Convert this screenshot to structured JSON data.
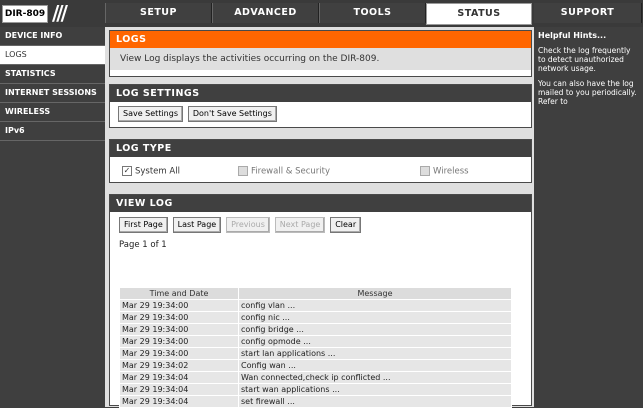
{
  "header": {
    "model": "DIR-809",
    "logo_slashes": "///",
    "tabs": [
      {
        "label": "SETUP"
      },
      {
        "label": "ADVANCED"
      },
      {
        "label": "TOOLS"
      },
      {
        "label": "STATUS"
      },
      {
        "label": "SUPPORT"
      }
    ],
    "active_tab": "STATUS"
  },
  "sidebar": {
    "items": [
      {
        "label": "DEVICE INFO"
      },
      {
        "label": "LOGS"
      },
      {
        "label": "STATISTICS"
      },
      {
        "label": "INTERNET SESSIONS"
      },
      {
        "label": "WIRELESS"
      },
      {
        "label": "IPv6"
      }
    ],
    "active": "LOGS"
  },
  "logs_section": {
    "title": "LOGS",
    "description": "View Log displays the activities occurring on the DIR-809."
  },
  "log_settings": {
    "title": "LOG SETTINGS",
    "save_label": "Save Settings",
    "dont_save_label": "Don't Save Settings"
  },
  "log_type": {
    "title": "LOG TYPE",
    "options": [
      {
        "label": "System All",
        "checked": true,
        "enabled": true
      },
      {
        "label": "Firewall & Security",
        "checked": false,
        "enabled": false
      },
      {
        "label": "Wireless",
        "checked": false,
        "enabled": false
      }
    ]
  },
  "view_log": {
    "title": "VIEW LOG",
    "buttons": {
      "first": "First Page",
      "last": "Last Page",
      "previous": "Previous",
      "next": "Next Page",
      "clear": "Clear"
    },
    "page_info": "Page 1 of 1",
    "columns": [
      "Time and Date",
      "Message"
    ],
    "rows": [
      [
        "Mar 29 19:34:00",
        "config vlan ..."
      ],
      [
        "Mar 29 19:34:00",
        "config nic ..."
      ],
      [
        "Mar 29 19:34:00",
        "config bridge ..."
      ],
      [
        "Mar 29 19:34:00",
        "config opmode ..."
      ],
      [
        "Mar 29 19:34:00",
        "start lan applications ..."
      ],
      [
        "Mar 29 19:34:02",
        "Config wan ..."
      ],
      [
        "Mar 29 19:34:04",
        "Wan connected,check ip conflicted ..."
      ],
      [
        "Mar 29 19:34:04",
        "start wan applications ..."
      ],
      [
        "Mar 29 19:34:04",
        "set firewall ..."
      ]
    ]
  },
  "hints": {
    "title": "Helpful Hints...",
    "paragraphs": [
      "Check the log frequently to detect unauthorized network usage.",
      "You can also have the log mailed to you periodically. Refer to"
    ]
  },
  "colors": {
    "accent": "#ff6600",
    "bar": "#404040",
    "background": "#3f3f3f"
  }
}
